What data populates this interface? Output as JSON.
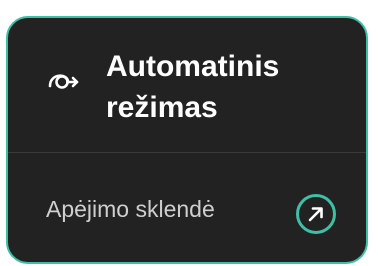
{
  "card": {
    "title_line1": "Automatinis",
    "title_line2": "režimas",
    "mode_icon": "auto-mode-icon",
    "link_label": "Apėjimo sklendė",
    "link_icon": "arrow-up-right-icon"
  },
  "colors": {
    "accent": "#3fbfa6",
    "background": "#222222",
    "title_text": "#ffffff",
    "label_text": "#cfcfcf",
    "divider": "#3a3a3a"
  }
}
